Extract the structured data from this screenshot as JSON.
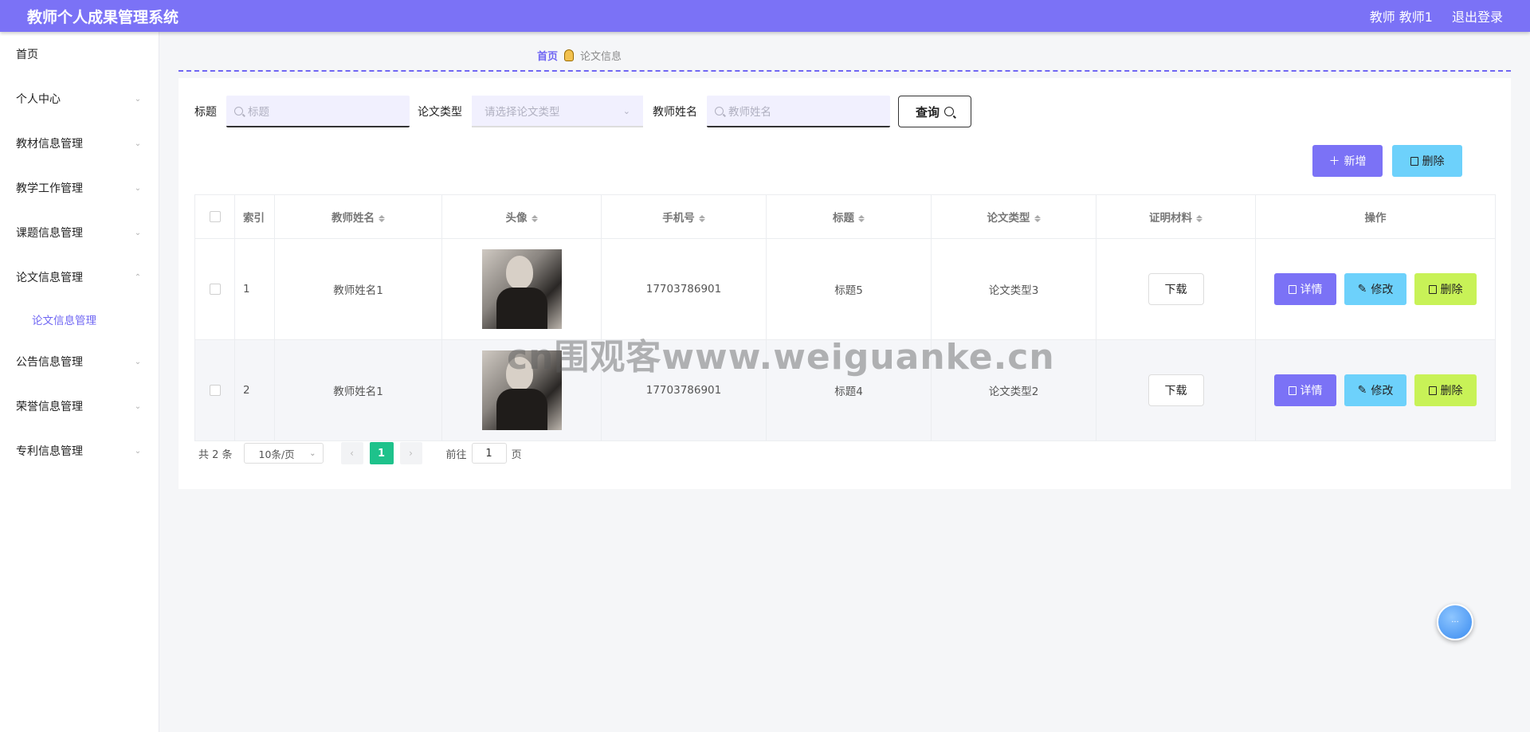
{
  "header": {
    "title": "教师个人成果管理系统",
    "user": "教师 教师1",
    "logout": "退出登录"
  },
  "sidebar": {
    "items": [
      {
        "label": "首页"
      },
      {
        "label": "个人中心"
      },
      {
        "label": "教材信息管理"
      },
      {
        "label": "教学工作管理"
      },
      {
        "label": "课题信息管理"
      },
      {
        "label": "论文信息管理"
      },
      {
        "label": "公告信息管理"
      },
      {
        "label": "荣誉信息管理"
      },
      {
        "label": "专利信息管理"
      }
    ],
    "sub_item": "论文信息管理"
  },
  "breadcrumb": {
    "home": "首页",
    "current": "论文信息"
  },
  "search": {
    "title_label": "标题",
    "title_placeholder": "标题",
    "type_label": "论文类型",
    "type_placeholder": "请选择论文类型",
    "teacher_label": "教师姓名",
    "teacher_placeholder": "教师姓名",
    "query": "查询"
  },
  "toolbar": {
    "add": "新增",
    "delete": "删除"
  },
  "table": {
    "headers": [
      "索引",
      "教师姓名",
      "头像",
      "手机号",
      "标题",
      "论文类型",
      "证明材料",
      "操作"
    ],
    "rows": [
      {
        "index": "1",
        "teacher": "教师姓名1",
        "phone": "17703786901",
        "title": "标题5",
        "type": "论文类型3",
        "download": "下载"
      },
      {
        "index": "2",
        "teacher": "教师姓名1",
        "phone": "17703786901",
        "title": "标题4",
        "type": "论文类型2",
        "download": "下载"
      }
    ],
    "actions": {
      "detail": "详情",
      "edit": "修改",
      "delete": "删除"
    }
  },
  "pagination": {
    "total": "共 2 条",
    "page_size": "10条/页",
    "current": "1",
    "goto_prefix": "前往",
    "goto_value": "1",
    "goto_suffix": "页"
  },
  "watermark": "cn围观客www.weiguanke.cn",
  "colors": {
    "primary": "#7b72f6",
    "info": "#6dd1fb",
    "danger": "#c8f257",
    "pager_active": "#1ec28b"
  }
}
